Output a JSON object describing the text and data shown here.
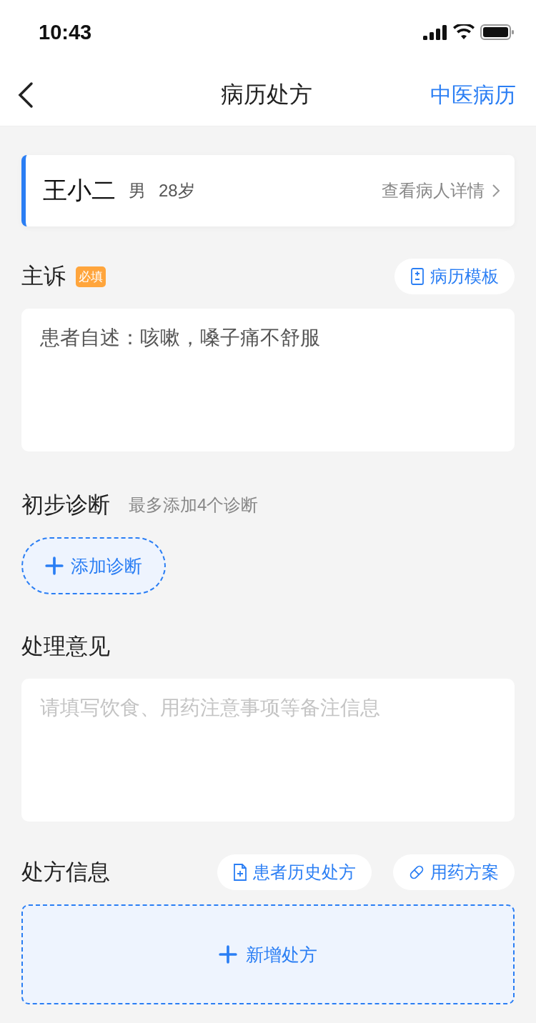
{
  "status_bar": {
    "time": "10:43"
  },
  "nav": {
    "title": "病历处方",
    "action": "中医病历"
  },
  "patient": {
    "name": "王小二",
    "gender": "男",
    "age": "28岁",
    "link": "查看病人详情"
  },
  "complaint": {
    "title": "主诉",
    "badge": "必填",
    "template_button": "病历模板",
    "value": "患者自述：咳嗽，嗓子痛不舒服"
  },
  "diagnosis": {
    "title": "初步诊断",
    "hint": "最多添加4个诊断",
    "add_button": "添加诊断"
  },
  "advice": {
    "title": "处理意见",
    "placeholder": "请填写饮食、用药注意事项等备注信息"
  },
  "prescription": {
    "title": "处方信息",
    "buttons": [
      {
        "kind": "history",
        "label": "患者历史处方"
      },
      {
        "kind": "plan",
        "label": "用药方案"
      }
    ],
    "add_button": "新增处方"
  }
}
